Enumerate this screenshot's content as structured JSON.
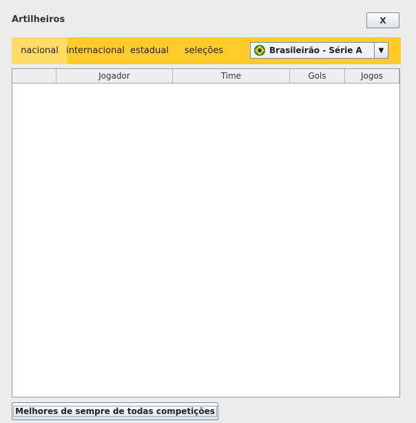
{
  "window": {
    "title": "Artilheiros",
    "close_label": "X"
  },
  "tabs": [
    {
      "label": "nacional",
      "active": true
    },
    {
      "label": "internacional",
      "active": false
    },
    {
      "label": "estadual",
      "active": false
    },
    {
      "label": "seleções",
      "active": false
    }
  ],
  "competition_select": {
    "selected": "Brasileirão - Série A",
    "icon": "brazil-flag-icon"
  },
  "table": {
    "columns": [
      "",
      "Jogador",
      "Time",
      "Gols",
      "Jogos"
    ],
    "rows": []
  },
  "footer": {
    "button_label": "Melhores de sempre de todas competições"
  },
  "colors": {
    "tabbar_bg": "#ffcc29",
    "tab_active_bg": "#ffdc66",
    "window_bg": "#ececec"
  }
}
